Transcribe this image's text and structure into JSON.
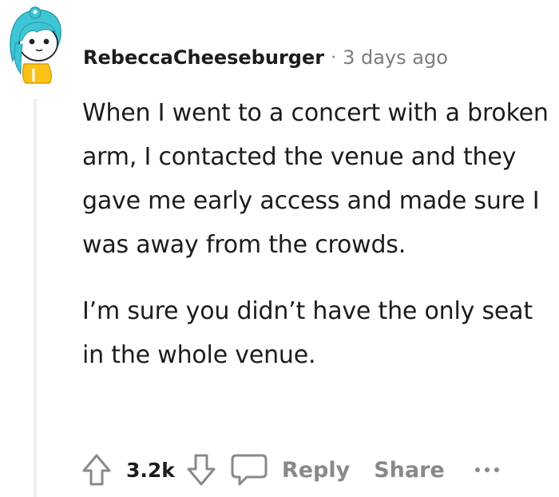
{
  "comment": {
    "author": "RebeccaCheeseburger",
    "separator": "·",
    "timestamp": "3 days ago",
    "paragraphs": [
      "When I went to a concert with a broken arm, I contacted the venue and they gave me early access and made sure I was away from the crowds.",
      "I’m sure you didn’t have the only seat in the whole venue."
    ]
  },
  "actions": {
    "score": "3.2k",
    "reply_label": "Reply",
    "share_label": "Share",
    "upvote_icon": "arrow-up-outline-icon",
    "downvote_icon": "arrow-down-outline-icon",
    "reply_icon": "speech-bubble-icon",
    "more_icon": "ellipsis-icon"
  },
  "colors": {
    "text": "#1c1c1c",
    "meta": "#7c7c7c",
    "action": "#878a8c",
    "thread_line": "#edeff1",
    "avatar_hair": "#3ec6d6",
    "avatar_body": "#f9c21a"
  }
}
